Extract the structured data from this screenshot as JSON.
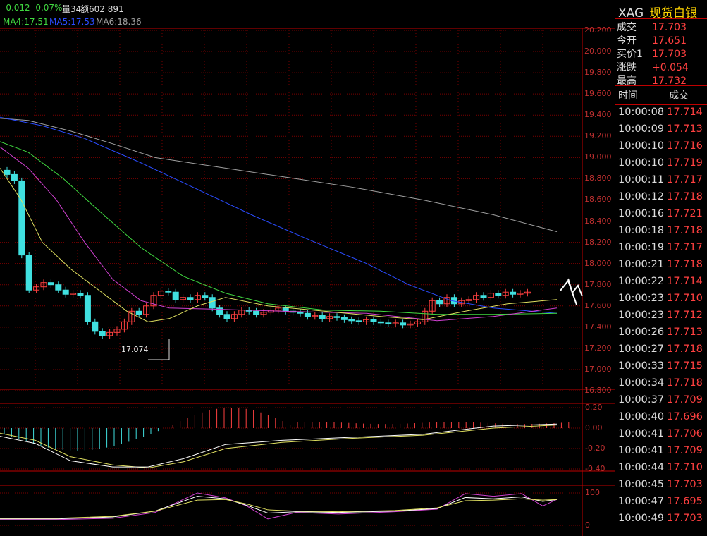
{
  "header": {
    "change": "-0.012",
    "change_pct": "-0.07%",
    "volume_label": "量34",
    "amount_label": "额602 891"
  },
  "ma_legend": [
    {
      "label": "MA4:17.51",
      "color": "#40d840"
    },
    {
      "label": "MA5:17.53",
      "color": "#2a4cff"
    },
    {
      "label": "MA6:18.36",
      "color": "#a0a0a0"
    }
  ],
  "price_axis": [
    "20.200",
    "20.000",
    "19.800",
    "19.600",
    "19.400",
    "19.200",
    "19.000",
    "18.800",
    "18.600",
    "18.400",
    "18.200",
    "18.000",
    "17.800",
    "17.600",
    "17.400",
    "17.200",
    "17.000",
    "16.800"
  ],
  "low_marker": "17.074",
  "macd_axis": [
    "0.20",
    "0.00",
    "-0.20",
    "-0.40"
  ],
  "kdj_axis": [
    "100",
    "0"
  ],
  "symbol": {
    "code": "XAG",
    "name": "现货白银"
  },
  "quote": [
    {
      "label": "成交",
      "value": "17.703"
    },
    {
      "label": "今开",
      "value": "17.651"
    },
    {
      "label": "买价1",
      "value": "17.703"
    },
    {
      "label": "涨跌",
      "value": "+0.054"
    },
    {
      "label": "最高",
      "value": "17.732"
    }
  ],
  "ticks_header": {
    "time": "时间",
    "price": "成交"
  },
  "ticks": [
    {
      "time": "10:00:08",
      "price": "17.714"
    },
    {
      "time": "10:00:09",
      "price": "17.713"
    },
    {
      "time": "10:00:10",
      "price": "17.716"
    },
    {
      "time": "10:00:10",
      "price": "17.719"
    },
    {
      "time": "10:00:11",
      "price": "17.717"
    },
    {
      "time": "10:00:12",
      "price": "17.718"
    },
    {
      "time": "10:00:16",
      "price": "17.721"
    },
    {
      "time": "10:00:18",
      "price": "17.718"
    },
    {
      "time": "10:00:19",
      "price": "17.717"
    },
    {
      "time": "10:00:21",
      "price": "17.718"
    },
    {
      "time": "10:00:22",
      "price": "17.714"
    },
    {
      "time": "10:00:23",
      "price": "17.710"
    },
    {
      "time": "10:00:23",
      "price": "17.712"
    },
    {
      "time": "10:00:26",
      "price": "17.713"
    },
    {
      "time": "10:00:27",
      "price": "17.718"
    },
    {
      "time": "10:00:33",
      "price": "17.715"
    },
    {
      "time": "10:00:34",
      "price": "17.718"
    },
    {
      "time": "10:00:37",
      "price": "17.709"
    },
    {
      "time": "10:00:40",
      "price": "17.696"
    },
    {
      "time": "10:00:41",
      "price": "17.706"
    },
    {
      "time": "10:00:41",
      "price": "17.709"
    },
    {
      "time": "10:00:44",
      "price": "17.710"
    },
    {
      "time": "10:00:45",
      "price": "17.703"
    },
    {
      "time": "10:00:47",
      "price": "17.695"
    },
    {
      "time": "10:00:49",
      "price": "17.703"
    }
  ],
  "colors": {
    "up": "#ff4040",
    "down": "#40e0e0",
    "grid": "#7a0000",
    "axis": "#c00000"
  }
}
